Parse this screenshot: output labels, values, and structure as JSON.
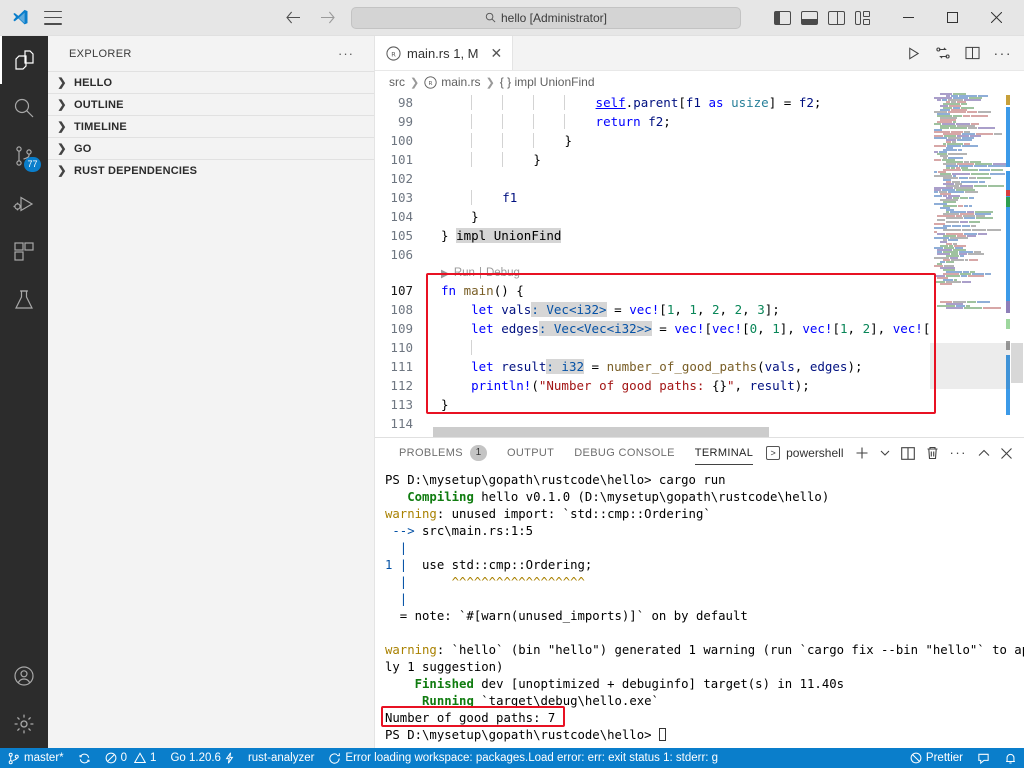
{
  "titlebar": {
    "logo_icon": "vscode-logo-icon",
    "menu_icon": "hamburger-menu-icon",
    "back_label": "←",
    "forward_label": "→",
    "quickinput": {
      "value": "hello [Administrator]",
      "placeholder": "Search",
      "icon": "search-icon"
    },
    "layout_icons": [
      "toggle-primary-sidebar-icon",
      "toggle-panel-icon",
      "toggle-secondary-sidebar-icon",
      "customize-layout-icon"
    ],
    "window_controls": {
      "minimize": "−",
      "maximize": "□",
      "close": "✕"
    }
  },
  "activitybar": {
    "items": [
      {
        "name": "explorer",
        "icon": "files-icon",
        "active": true,
        "badge": ""
      },
      {
        "name": "search",
        "icon": "search-icon",
        "active": false,
        "badge": ""
      },
      {
        "name": "source-control",
        "icon": "source-control-icon",
        "active": false,
        "badge": "77"
      },
      {
        "name": "run-and-debug",
        "icon": "run-and-debug-icon",
        "active": false,
        "badge": ""
      },
      {
        "name": "extensions",
        "icon": "extensions-icon",
        "active": false,
        "badge": ""
      },
      {
        "name": "testing",
        "icon": "beaker-icon",
        "active": false,
        "badge": ""
      }
    ],
    "bottom": [
      {
        "name": "accounts",
        "icon": "account-icon"
      },
      {
        "name": "manage",
        "icon": "gear-icon"
      }
    ]
  },
  "sidebar": {
    "title": "EXPLORER",
    "more_label": "···",
    "sections": [
      {
        "label": "HELLO",
        "expanded": false
      },
      {
        "label": "OUTLINE",
        "expanded": false
      },
      {
        "label": "TIMELINE",
        "expanded": false
      },
      {
        "label": "GO",
        "expanded": false
      },
      {
        "label": "RUST DEPENDENCIES",
        "expanded": false
      }
    ]
  },
  "editor": {
    "tabs": [
      {
        "label": "main.rs 1, M",
        "icon": "rust-file-icon",
        "active": true,
        "close_label": "✕"
      }
    ],
    "tab_actions": [
      "run-file-icon",
      "run-and-debug-icon",
      "split-editor-icon",
      "more-actions-icon"
    ],
    "breadcrumb": [
      "src",
      "main.rs",
      "{ } impl UnionFind"
    ],
    "codelens": {
      "run": "Run",
      "divider": "|",
      "debug": "Debug"
    },
    "lines": [
      {
        "n": "98",
        "text": "                self.parent[f1 as usize] = f2;"
      },
      {
        "n": "99",
        "text": "                return f2;"
      },
      {
        "n": "100",
        "text": "            }"
      },
      {
        "n": "101",
        "text": "        }"
      },
      {
        "n": "102",
        "text": ""
      },
      {
        "n": "103",
        "text": "        f1"
      },
      {
        "n": "104",
        "text": "    }"
      },
      {
        "n": "105",
        "text": "} impl UnionFind"
      },
      {
        "n": "106",
        "text": ""
      },
      {
        "n": "107",
        "text": "fn main() {"
      },
      {
        "n": "108",
        "text": "    let vals: Vec<i32> = vec![1, 1, 2, 2, 3];"
      },
      {
        "n": "109",
        "text": "    let edges: Vec<Vec<i32>> = vec![vec![0, 1], vec![1, 2], vec!["
      },
      {
        "n": "110",
        "text": ""
      },
      {
        "n": "111",
        "text": "    let result: i32 = number_of_good_paths(vals, edges);"
      },
      {
        "n": "112",
        "text": "    println!(\"Number of good paths: {}\", result);"
      },
      {
        "n": "113",
        "text": "}"
      },
      {
        "n": "114",
        "text": ""
      }
    ]
  },
  "panel": {
    "tabs": [
      {
        "label": "PROBLEMS",
        "badge": "1",
        "active": false
      },
      {
        "label": "OUTPUT",
        "badge": "",
        "active": false
      },
      {
        "label": "DEBUG CONSOLE",
        "badge": "",
        "active": false
      },
      {
        "label": "TERMINAL",
        "badge": "",
        "active": true
      }
    ],
    "shell": {
      "label": "powershell",
      "icon": "terminal-icon"
    },
    "actions": [
      "new-terminal-icon",
      "split-terminal-icon",
      "kill-terminal-icon",
      "more-actions-icon",
      "maximize-panel-icon",
      "close-panel-icon"
    ],
    "terminal_lines": [
      {
        "segments": [
          {
            "t": "PS D:\\mysetup\\gopath\\rustcode\\hello> cargo run",
            "c": ""
          }
        ]
      },
      {
        "segments": [
          {
            "t": "   ",
            "c": ""
          },
          {
            "t": "Compiling",
            "c": "t-green"
          },
          {
            "t": " hello v0.1.0 (D:\\mysetup\\gopath\\rustcode\\hello)",
            "c": ""
          }
        ]
      },
      {
        "segments": [
          {
            "t": "warning",
            "c": "t-yellow"
          },
          {
            "t": ": unused import: `std::cmp::Ordering`",
            "c": ""
          }
        ]
      },
      {
        "segments": [
          {
            "t": " --> ",
            "c": "t-blue"
          },
          {
            "t": "src\\main.rs:1:5",
            "c": ""
          }
        ]
      },
      {
        "segments": [
          {
            "t": "  |",
            "c": "t-blue"
          }
        ]
      },
      {
        "segments": [
          {
            "t": "1 |",
            "c": "t-blue"
          },
          {
            "t": "  use std::cmp::Ordering;",
            "c": ""
          }
        ]
      },
      {
        "segments": [
          {
            "t": "  |",
            "c": "t-blue"
          },
          {
            "t": "      ",
            "c": ""
          },
          {
            "t": "^^^^^^^^^^^^^^^^^^",
            "c": "t-yellow"
          }
        ]
      },
      {
        "segments": [
          {
            "t": "  |",
            "c": "t-blue"
          }
        ]
      },
      {
        "segments": [
          {
            "t": "  = note: `#[warn(unused_imports)]` on by default",
            "c": ""
          }
        ]
      },
      {
        "segments": [
          {
            "t": "",
            "c": ""
          }
        ]
      },
      {
        "segments": [
          {
            "t": "warning",
            "c": "t-yellow"
          },
          {
            "t": ": `hello` (bin \"hello\") generated 1 warning (run `cargo fix --bin \"hello\"` to app",
            "c": ""
          }
        ]
      },
      {
        "segments": [
          {
            "t": "ly 1 suggestion)",
            "c": ""
          }
        ]
      },
      {
        "segments": [
          {
            "t": "    ",
            "c": ""
          },
          {
            "t": "Finished",
            "c": "t-green"
          },
          {
            "t": " dev [unoptimized + debuginfo] target(s) in 11.40s",
            "c": ""
          }
        ]
      },
      {
        "segments": [
          {
            "t": "     ",
            "c": ""
          },
          {
            "t": "Running",
            "c": "t-green"
          },
          {
            "t": " `target\\debug\\hello.exe`",
            "c": ""
          }
        ]
      },
      {
        "segments": [
          {
            "t": "Number of good paths: 7",
            "c": ""
          }
        ]
      },
      {
        "segments": [
          {
            "t": "PS D:\\mysetup\\gopath\\rustcode\\hello> ",
            "c": ""
          }
        ]
      }
    ]
  },
  "statusbar": {
    "left": [
      {
        "icon": "remote-branch-icon",
        "label": "master*"
      },
      {
        "icon": "sync-icon",
        "label": ""
      },
      {
        "icon": "error-warning-icon",
        "label": "0  1",
        "errors": "0",
        "warnings": "1"
      },
      {
        "icon": "go-icon",
        "label": "Go 1.20.6"
      },
      {
        "icon": "",
        "label": "rust-analyzer"
      },
      {
        "icon": "loading-icon",
        "label": "Error loading workspace: packages.Load error: err: exit status 1: stderr: g"
      }
    ],
    "right": [
      {
        "icon": "prettier-icon",
        "label": "Prettier"
      },
      {
        "icon": "feedback-icon",
        "label": ""
      },
      {
        "icon": "bell-icon",
        "label": ""
      }
    ],
    "accent": "#0a7ecb"
  },
  "annotations": {
    "boxes": [
      {
        "name": "main-function-highlight"
      },
      {
        "name": "program-output-highlight"
      }
    ]
  }
}
